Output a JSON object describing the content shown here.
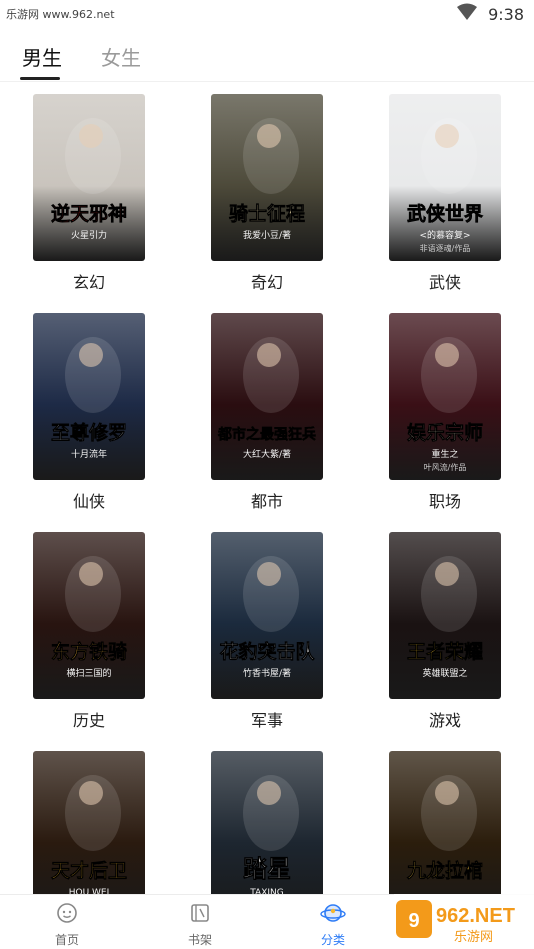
{
  "status_bar": {
    "site_text": "乐游网 www.962.net",
    "time": "9:38"
  },
  "tabs": [
    {
      "label": "男生",
      "active": true
    },
    {
      "label": "女生",
      "active": false
    }
  ],
  "categories": [
    {
      "label": "玄幻",
      "cover_title": "逆天邪神",
      "cover_subtitle": "火星引力",
      "bg": "#c9c4bd",
      "accent": "#b3221e"
    },
    {
      "label": "奇幻",
      "cover_title": "骑士征程",
      "cover_subtitle": "我爱小豆/著",
      "bg": "#4d4a3a",
      "accent": "#e9d8a8"
    },
    {
      "label": "武侠",
      "cover_title": "武侠世界",
      "cover_subtitle": "<的慕容复>",
      "cover_caption": "非语逐魂/作品",
      "bg": "#e8e9ea",
      "accent": "#2a2a2a"
    },
    {
      "label": "仙侠",
      "cover_title": "至尊修罗",
      "cover_subtitle": "十月流年",
      "bg": "#1d2a46",
      "accent": "#e9eef8"
    },
    {
      "label": "都市",
      "cover_title": "都市之最强狂兵",
      "cover_subtitle": "大红大紫/著",
      "bg": "#2a0d10",
      "accent": "#f3c33a"
    },
    {
      "label": "职场",
      "cover_title": "娱乐宗师",
      "cover_subtitle": "重生之",
      "cover_caption": "叶风流/作品",
      "bg": "#3a0f16",
      "accent": "#f1e1c8"
    },
    {
      "label": "历史",
      "cover_title": "东方铁骑",
      "cover_subtitle": "横扫三国的",
      "bg": "#281410",
      "accent": "#f1b13a"
    },
    {
      "label": "军事",
      "cover_title": "花豹突击队",
      "cover_subtitle": "竹香书屋/著",
      "bg": "#1b2a3d",
      "accent": "#ffffff"
    },
    {
      "label": "游戏",
      "cover_title": "王者荣耀",
      "cover_subtitle": "英雄联盟之",
      "bg": "#1a1212",
      "accent": "#f5c22f"
    },
    {
      "label": "",
      "cover_title": "天才后卫",
      "cover_subtitle": "HOU WEI",
      "bg": "#2a1a0f",
      "accent": "#f3b52c"
    },
    {
      "label": "",
      "cover_title": "踏星",
      "cover_subtitle": "TAXING",
      "bg": "#1d2630",
      "accent": "#ffffff"
    },
    {
      "label": "",
      "cover_title": "九龙拉棺",
      "cover_subtitle": "",
      "bg": "#2b1d0c",
      "accent": "#f0c040"
    }
  ],
  "bottom_nav": [
    {
      "label": "首页",
      "icon": "home-face-icon",
      "active": false
    },
    {
      "label": "书架",
      "icon": "bookshelf-icon",
      "active": false
    },
    {
      "label": "分类",
      "icon": "category-planet-icon",
      "active": true
    }
  ],
  "watermark": {
    "text": "962.NET",
    "sub": "乐游网"
  },
  "colors": {
    "accent_blue": "#2e7cf6",
    "text_dark": "#222222",
    "text_muted": "#9a9a9a"
  }
}
